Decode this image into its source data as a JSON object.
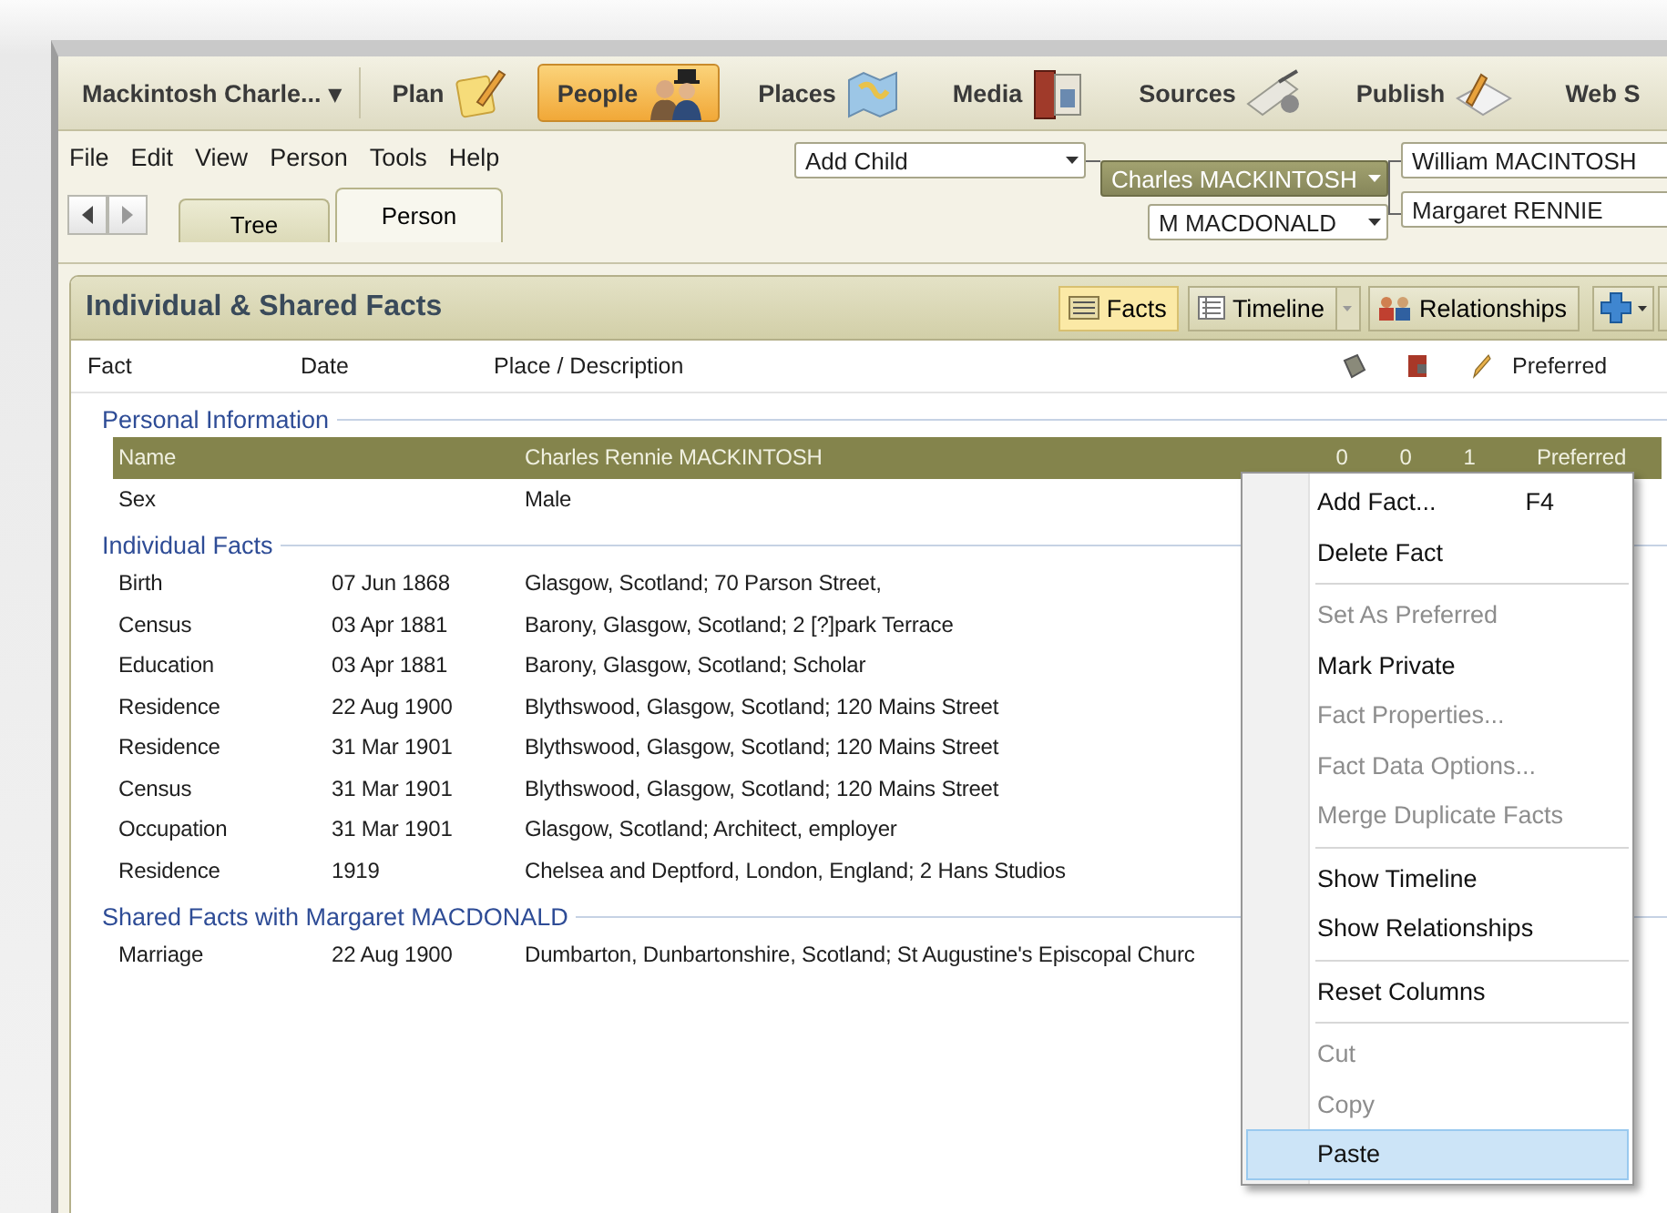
{
  "tree_selector": {
    "label": "Mackintosh Charle...",
    "caret": "▾"
  },
  "nav": [
    {
      "label": "Plan",
      "kind": "plan",
      "selected": false
    },
    {
      "label": "People",
      "kind": "people",
      "selected": true
    },
    {
      "label": "Places",
      "kind": "places",
      "selected": false
    },
    {
      "label": "Media",
      "kind": "media",
      "selected": false
    },
    {
      "label": "Sources",
      "kind": "sources",
      "selected": false
    },
    {
      "label": "Publish",
      "kind": "publish",
      "selected": false
    },
    {
      "label": "Web S",
      "kind": "text",
      "selected": false
    }
  ],
  "menu": [
    "File",
    "Edit",
    "View",
    "Person",
    "Tools",
    "Help"
  ],
  "view_tabs": [
    {
      "label": "Tree",
      "selected": false
    },
    {
      "label": "Person",
      "selected": true
    }
  ],
  "family": {
    "child_action": "Add Child",
    "person": "Charles MACKINTOSH",
    "spouse": "M MACDONALD",
    "father": "William MACINTOSH",
    "mother": "Margaret RENNIE"
  },
  "panel": {
    "title": "Individual & Shared Facts",
    "views": [
      {
        "label": "Facts",
        "kind": "facts",
        "selected": true
      },
      {
        "label": "Timeline",
        "kind": "timeline",
        "selected": false
      },
      {
        "label": "Relationships",
        "kind": "relationships",
        "selected": false
      }
    ],
    "columns": [
      {
        "kind": "text",
        "label": "Fact"
      },
      {
        "kind": "text",
        "label": "Date"
      },
      {
        "kind": "text",
        "label": "Place / Description"
      },
      {
        "kind": "sources"
      },
      {
        "kind": "media"
      },
      {
        "kind": "notes"
      },
      {
        "kind": "text",
        "label": "Preferred"
      }
    ],
    "groups": [
      {
        "title": "Personal Information",
        "rows": [
          {
            "fact": "Name",
            "place": "Charles Rennie MACKINTOSH",
            "counts": [
              "0",
              "0",
              "1"
            ],
            "preferred": "Preferred",
            "selected": true
          },
          {
            "fact": "Sex",
            "place": "Male",
            "selected": false
          }
        ]
      },
      {
        "title": "Individual Facts",
        "rows": [
          {
            "fact": "Birth",
            "date": "07 Jun 1868",
            "place": "Glasgow, Scotland; 70 Parson Street,",
            "selected": false
          },
          {
            "fact": "Census",
            "date": "03 Apr 1881",
            "place": "Barony, Glasgow, Scotland; 2 [?]park Terrace",
            "selected": false
          },
          {
            "fact": "Education",
            "date": "03 Apr 1881",
            "place": "Barony, Glasgow, Scotland; Scholar",
            "selected": false
          },
          {
            "fact": "Residence",
            "date": "22 Aug 1900",
            "place": "Blythswood, Glasgow, Scotland; 120 Mains Street",
            "selected": false
          },
          {
            "fact": "Residence",
            "date": "31 Mar 1901",
            "place": "Blythswood, Glasgow, Scotland; 120 Mains Street",
            "selected": false
          },
          {
            "fact": "Census",
            "date": "31 Mar 1901",
            "place": "Blythswood, Glasgow, Scotland; 120 Mains Street",
            "selected": false
          },
          {
            "fact": "Occupation",
            "date": "31 Mar 1901",
            "place": "Glasgow, Scotland; Architect, employer",
            "selected": false
          },
          {
            "fact": "Residence",
            "date": "1919",
            "place": "Chelsea and Deptford, London, England; 2 Hans Studios",
            "selected": false
          }
        ]
      },
      {
        "title": "Shared Facts with Margaret MACDONALD",
        "rows": [
          {
            "fact": "Marriage",
            "date": "22 Aug 1900",
            "place": "Dumbarton, Dunbartonshire, Scotland; St Augustine's Episcopal Churc",
            "selected": false
          }
        ]
      }
    ]
  },
  "context_menu": [
    {
      "kind": "item",
      "label": "Add Fact...",
      "shortcut": "F4",
      "disabled": false,
      "selected": false
    },
    {
      "kind": "item",
      "label": "Delete Fact",
      "disabled": false,
      "selected": false
    },
    {
      "kind": "separator"
    },
    {
      "kind": "item",
      "label": "Set As Preferred",
      "disabled": true,
      "selected": false
    },
    {
      "kind": "item",
      "label": "Mark Private",
      "disabled": false,
      "selected": false
    },
    {
      "kind": "item",
      "label": "Fact Properties...",
      "disabled": true,
      "selected": false
    },
    {
      "kind": "item",
      "label": "Fact Data Options...",
      "disabled": true,
      "selected": false
    },
    {
      "kind": "item",
      "label": "Merge Duplicate Facts",
      "disabled": true,
      "selected": false
    },
    {
      "kind": "separator"
    },
    {
      "kind": "item",
      "label": "Show Timeline",
      "disabled": false,
      "selected": false
    },
    {
      "kind": "item",
      "label": "Show Relationships",
      "disabled": false,
      "selected": false
    },
    {
      "kind": "separator"
    },
    {
      "kind": "item",
      "label": "Reset Columns",
      "disabled": false,
      "selected": false
    },
    {
      "kind": "separator"
    },
    {
      "kind": "item",
      "label": "Cut",
      "disabled": true,
      "selected": false
    },
    {
      "kind": "item",
      "label": "Copy",
      "disabled": true,
      "selected": false
    },
    {
      "kind": "item",
      "label": "Paste",
      "disabled": false,
      "selected": true
    }
  ]
}
